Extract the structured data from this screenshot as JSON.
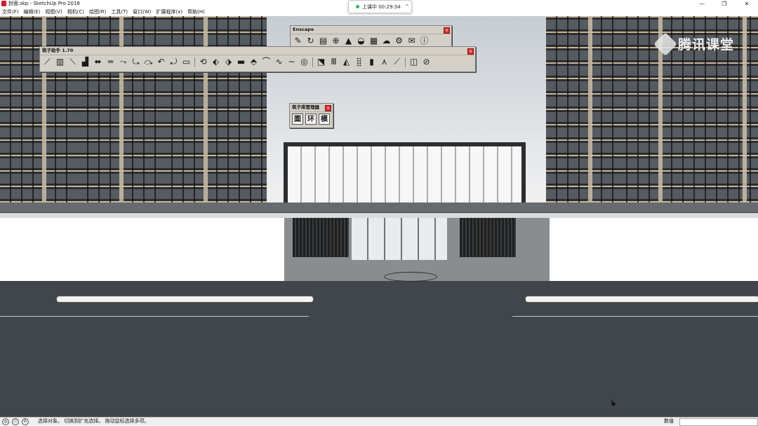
{
  "window": {
    "title": "封面.skp - SketchUp Pro 2018",
    "minimize": "—",
    "maximize": "❐",
    "close": "✕"
  },
  "menu": [
    "文件(F)",
    "编辑(E)",
    "视图(V)",
    "相机(C)",
    "绘图(R)",
    "工具(T)",
    "窗口(W)",
    "扩展程序(x)",
    "帮助(H)"
  ],
  "recording": {
    "status": "上课中 00:29:34",
    "indicator_color": "#2bbf5b"
  },
  "watermark": {
    "text": "腾讯课堂"
  },
  "toolbars": {
    "enscape": {
      "title": "Enscape",
      "tools": [
        "enscape-start-icon",
        "refresh-icon",
        "sync-icon",
        "add-icon",
        "tree-icon",
        "sun-icon",
        "material-icon",
        "upload-icon",
        "settings-icon",
        "mail-icon",
        "info-icon"
      ],
      "glyphs": [
        "✎",
        "↻",
        "▤",
        "⊕",
        "▲",
        "◒",
        "▦",
        "☁",
        "⚙",
        "✉",
        "ⓘ"
      ]
    },
    "zhuzi": {
      "title": "筑子助手 1.70",
      "glyphs": [
        "⟋",
        "▥",
        "⟍",
        "▟",
        "⬌",
        "═",
        "⤳",
        "⤿",
        "⤼",
        "↶",
        "⤾",
        "▭",
        "⟲",
        "⬖",
        "⬗",
        "▬",
        "⬘",
        "⌒",
        "∿",
        "∼",
        "◎",
        "⬔",
        "Ⅲ",
        "◭",
        "⣿",
        "▮",
        "⋏",
        "⟋",
        "◫",
        "⊘"
      ]
    },
    "library": {
      "title": "筑子库管理器",
      "buttons": [
        "圄",
        "环",
        "模"
      ]
    }
  },
  "statusbar": {
    "prompt": "选择对象。 切换到扩充选择。 拖动鼠标选择多项。",
    "measurement_label": "数值",
    "measurement_value": ""
  },
  "colors": {
    "road": "#40464b",
    "close_button": "#d8322f",
    "toolbar_bg": "#d4d0c8"
  }
}
